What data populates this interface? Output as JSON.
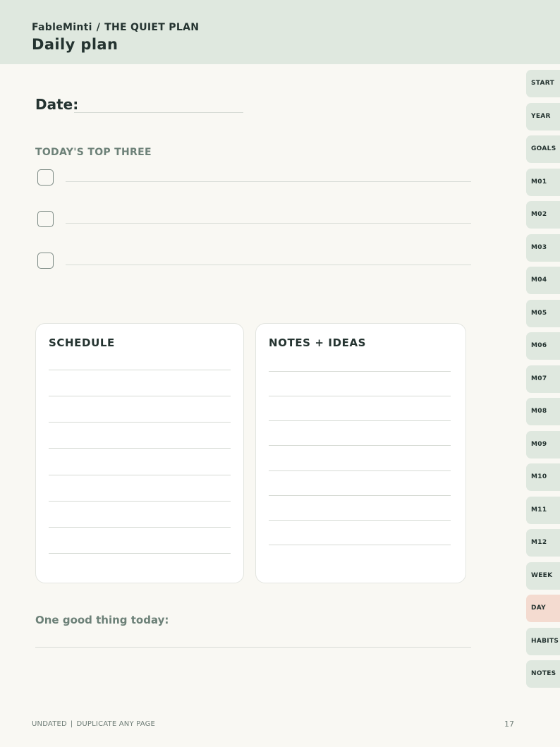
{
  "header": {
    "brand": "FableMinti",
    "separator": "/",
    "plan_name": "THE QUIET PLAN",
    "title": "Daily plan"
  },
  "date_label": "Date:",
  "top_three": {
    "title": "TODAY'S TOP THREE",
    "items": [
      "",
      "",
      ""
    ]
  },
  "schedule": {
    "title": "SCHEDULE"
  },
  "notes": {
    "title": "NOTES + IDEAS"
  },
  "one_good_thing": "One good thing today:",
  "footer": {
    "left_a": "UNDATED",
    "left_sep": "|",
    "left_b": "DUPLICATE ANY PAGE",
    "page_number": "17"
  },
  "tabs": [
    {
      "label": "START",
      "active": false
    },
    {
      "label": "YEAR",
      "active": false
    },
    {
      "label": "GOALS",
      "active": false
    },
    {
      "label": "M01",
      "active": false
    },
    {
      "label": "M02",
      "active": false
    },
    {
      "label": "M03",
      "active": false
    },
    {
      "label": "M04",
      "active": false
    },
    {
      "label": "M05",
      "active": false
    },
    {
      "label": "M06",
      "active": false
    },
    {
      "label": "M07",
      "active": false
    },
    {
      "label": "M08",
      "active": false
    },
    {
      "label": "M09",
      "active": false
    },
    {
      "label": "M10",
      "active": false
    },
    {
      "label": "M11",
      "active": false
    },
    {
      "label": "M12",
      "active": false
    },
    {
      "label": "WEEK",
      "active": false
    },
    {
      "label": "DAY",
      "active": true
    },
    {
      "label": "HABITS",
      "active": false
    },
    {
      "label": "NOTES",
      "active": false
    }
  ],
  "colors": {
    "header_bg": "#dfe8df",
    "page_bg": "#f9f8f3",
    "tab_bg": "#dfe8df",
    "tab_active_bg": "#f4dbd0",
    "accent_text": "#6d8178"
  }
}
